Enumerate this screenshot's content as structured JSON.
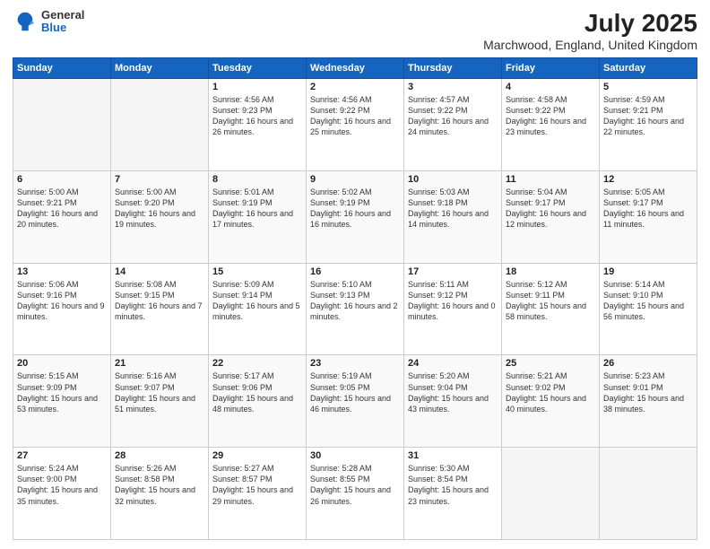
{
  "header": {
    "logo_line1": "General",
    "logo_line2": "Blue",
    "title": "July 2025",
    "subtitle": "Marchwood, England, United Kingdom"
  },
  "days_of_week": [
    "Sunday",
    "Monday",
    "Tuesday",
    "Wednesday",
    "Thursday",
    "Friday",
    "Saturday"
  ],
  "weeks": [
    [
      {
        "day": "",
        "empty": true
      },
      {
        "day": "",
        "empty": true
      },
      {
        "day": "1",
        "sunrise": "Sunrise: 4:56 AM",
        "sunset": "Sunset: 9:23 PM",
        "daylight": "Daylight: 16 hours and 26 minutes."
      },
      {
        "day": "2",
        "sunrise": "Sunrise: 4:56 AM",
        "sunset": "Sunset: 9:22 PM",
        "daylight": "Daylight: 16 hours and 25 minutes."
      },
      {
        "day": "3",
        "sunrise": "Sunrise: 4:57 AM",
        "sunset": "Sunset: 9:22 PM",
        "daylight": "Daylight: 16 hours and 24 minutes."
      },
      {
        "day": "4",
        "sunrise": "Sunrise: 4:58 AM",
        "sunset": "Sunset: 9:22 PM",
        "daylight": "Daylight: 16 hours and 23 minutes."
      },
      {
        "day": "5",
        "sunrise": "Sunrise: 4:59 AM",
        "sunset": "Sunset: 9:21 PM",
        "daylight": "Daylight: 16 hours and 22 minutes."
      }
    ],
    [
      {
        "day": "6",
        "sunrise": "Sunrise: 5:00 AM",
        "sunset": "Sunset: 9:21 PM",
        "daylight": "Daylight: 16 hours and 20 minutes."
      },
      {
        "day": "7",
        "sunrise": "Sunrise: 5:00 AM",
        "sunset": "Sunset: 9:20 PM",
        "daylight": "Daylight: 16 hours and 19 minutes."
      },
      {
        "day": "8",
        "sunrise": "Sunrise: 5:01 AM",
        "sunset": "Sunset: 9:19 PM",
        "daylight": "Daylight: 16 hours and 17 minutes."
      },
      {
        "day": "9",
        "sunrise": "Sunrise: 5:02 AM",
        "sunset": "Sunset: 9:19 PM",
        "daylight": "Daylight: 16 hours and 16 minutes."
      },
      {
        "day": "10",
        "sunrise": "Sunrise: 5:03 AM",
        "sunset": "Sunset: 9:18 PM",
        "daylight": "Daylight: 16 hours and 14 minutes."
      },
      {
        "day": "11",
        "sunrise": "Sunrise: 5:04 AM",
        "sunset": "Sunset: 9:17 PM",
        "daylight": "Daylight: 16 hours and 12 minutes."
      },
      {
        "day": "12",
        "sunrise": "Sunrise: 5:05 AM",
        "sunset": "Sunset: 9:17 PM",
        "daylight": "Daylight: 16 hours and 11 minutes."
      }
    ],
    [
      {
        "day": "13",
        "sunrise": "Sunrise: 5:06 AM",
        "sunset": "Sunset: 9:16 PM",
        "daylight": "Daylight: 16 hours and 9 minutes."
      },
      {
        "day": "14",
        "sunrise": "Sunrise: 5:08 AM",
        "sunset": "Sunset: 9:15 PM",
        "daylight": "Daylight: 16 hours and 7 minutes."
      },
      {
        "day": "15",
        "sunrise": "Sunrise: 5:09 AM",
        "sunset": "Sunset: 9:14 PM",
        "daylight": "Daylight: 16 hours and 5 minutes."
      },
      {
        "day": "16",
        "sunrise": "Sunrise: 5:10 AM",
        "sunset": "Sunset: 9:13 PM",
        "daylight": "Daylight: 16 hours and 2 minutes."
      },
      {
        "day": "17",
        "sunrise": "Sunrise: 5:11 AM",
        "sunset": "Sunset: 9:12 PM",
        "daylight": "Daylight: 16 hours and 0 minutes."
      },
      {
        "day": "18",
        "sunrise": "Sunrise: 5:12 AM",
        "sunset": "Sunset: 9:11 PM",
        "daylight": "Daylight: 15 hours and 58 minutes."
      },
      {
        "day": "19",
        "sunrise": "Sunrise: 5:14 AM",
        "sunset": "Sunset: 9:10 PM",
        "daylight": "Daylight: 15 hours and 56 minutes."
      }
    ],
    [
      {
        "day": "20",
        "sunrise": "Sunrise: 5:15 AM",
        "sunset": "Sunset: 9:09 PM",
        "daylight": "Daylight: 15 hours and 53 minutes."
      },
      {
        "day": "21",
        "sunrise": "Sunrise: 5:16 AM",
        "sunset": "Sunset: 9:07 PM",
        "daylight": "Daylight: 15 hours and 51 minutes."
      },
      {
        "day": "22",
        "sunrise": "Sunrise: 5:17 AM",
        "sunset": "Sunset: 9:06 PM",
        "daylight": "Daylight: 15 hours and 48 minutes."
      },
      {
        "day": "23",
        "sunrise": "Sunrise: 5:19 AM",
        "sunset": "Sunset: 9:05 PM",
        "daylight": "Daylight: 15 hours and 46 minutes."
      },
      {
        "day": "24",
        "sunrise": "Sunrise: 5:20 AM",
        "sunset": "Sunset: 9:04 PM",
        "daylight": "Daylight: 15 hours and 43 minutes."
      },
      {
        "day": "25",
        "sunrise": "Sunrise: 5:21 AM",
        "sunset": "Sunset: 9:02 PM",
        "daylight": "Daylight: 15 hours and 40 minutes."
      },
      {
        "day": "26",
        "sunrise": "Sunrise: 5:23 AM",
        "sunset": "Sunset: 9:01 PM",
        "daylight": "Daylight: 15 hours and 38 minutes."
      }
    ],
    [
      {
        "day": "27",
        "sunrise": "Sunrise: 5:24 AM",
        "sunset": "Sunset: 9:00 PM",
        "daylight": "Daylight: 15 hours and 35 minutes."
      },
      {
        "day": "28",
        "sunrise": "Sunrise: 5:26 AM",
        "sunset": "Sunset: 8:58 PM",
        "daylight": "Daylight: 15 hours and 32 minutes."
      },
      {
        "day": "29",
        "sunrise": "Sunrise: 5:27 AM",
        "sunset": "Sunset: 8:57 PM",
        "daylight": "Daylight: 15 hours and 29 minutes."
      },
      {
        "day": "30",
        "sunrise": "Sunrise: 5:28 AM",
        "sunset": "Sunset: 8:55 PM",
        "daylight": "Daylight: 15 hours and 26 minutes."
      },
      {
        "day": "31",
        "sunrise": "Sunrise: 5:30 AM",
        "sunset": "Sunset: 8:54 PM",
        "daylight": "Daylight: 15 hours and 23 minutes."
      },
      {
        "day": "",
        "empty": true
      },
      {
        "day": "",
        "empty": true
      }
    ]
  ]
}
